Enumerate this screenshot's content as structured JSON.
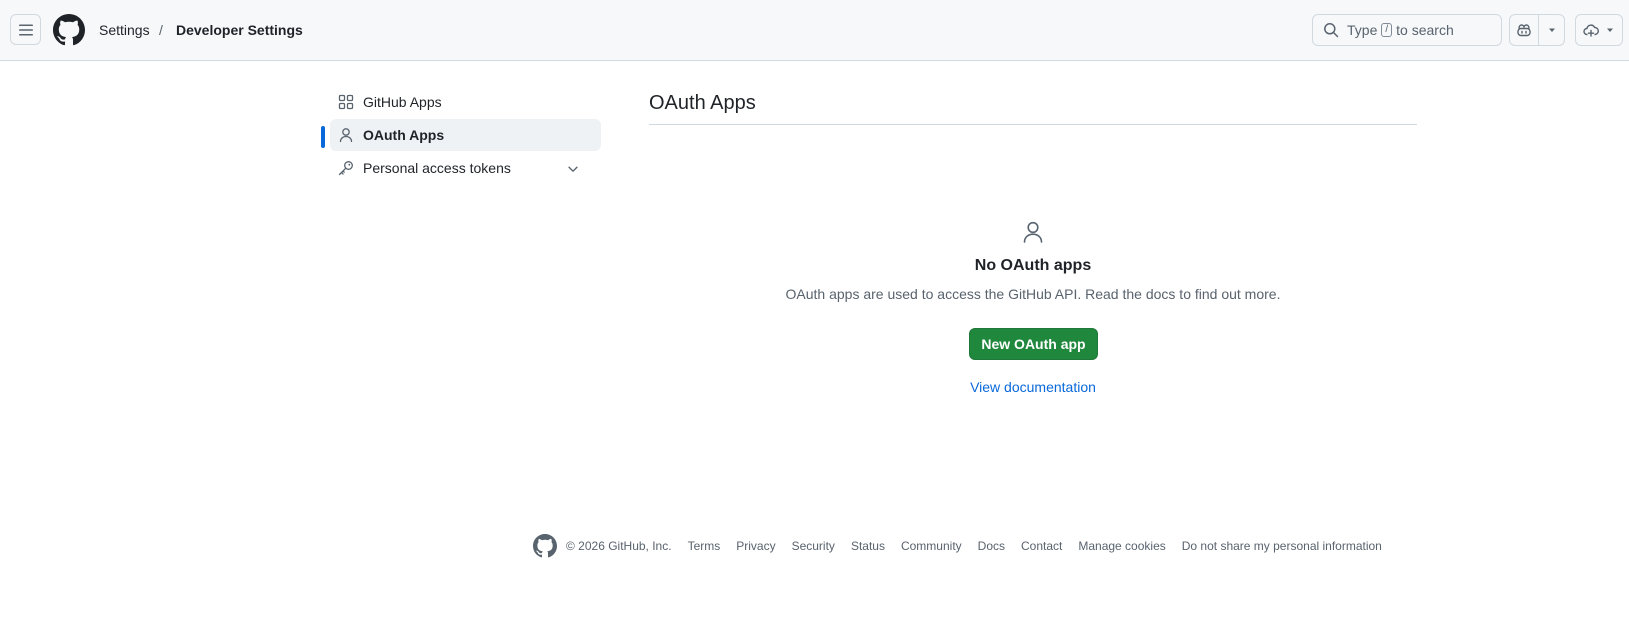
{
  "header": {
    "menu_icon": "three-bars-icon",
    "logo_icon": "github-mark-icon",
    "breadcrumb": [
      "Settings",
      "Developer Settings"
    ],
    "breadcrumb_separator": "/",
    "search": {
      "prefix": "Type",
      "key": "/",
      "suffix": "to search"
    },
    "copilot_icon": "copilot-icon",
    "create_icon": "cloud-plus-icon"
  },
  "sidebar": {
    "items": [
      {
        "label": "GitHub Apps",
        "icon": "apps-icon",
        "active": false
      },
      {
        "label": "OAuth Apps",
        "icon": "person-icon",
        "active": true
      },
      {
        "label": "Personal access tokens",
        "icon": "key-icon",
        "active": false,
        "expandable": true
      }
    ]
  },
  "main": {
    "title": "OAuth Apps",
    "blankslate": {
      "icon": "person-icon",
      "title": "No OAuth apps",
      "description": "OAuth apps are used to access the GitHub API. Read the docs to find out more.",
      "primary_button": "New OAuth app",
      "secondary_link": "View documentation"
    }
  },
  "footer": {
    "copyright": "© 2026 GitHub, Inc.",
    "links": [
      "Terms",
      "Privacy",
      "Security",
      "Status",
      "Community",
      "Docs",
      "Contact",
      "Manage cookies",
      "Do not share my personal information"
    ]
  },
  "colors": {
    "accent": "#0969da",
    "primary_button": "#1f883d",
    "header_bg": "#f6f8fa",
    "border": "#d1d9e0"
  }
}
